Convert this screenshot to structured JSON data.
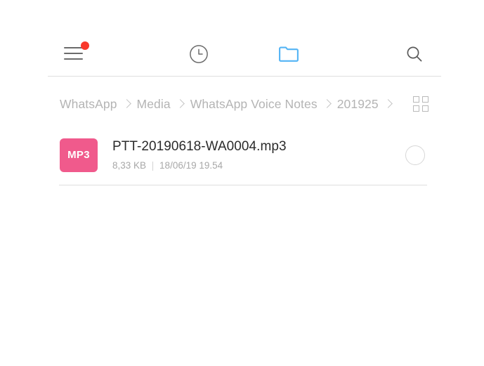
{
  "toolbar": {
    "menu": {
      "name": "menu-button",
      "label": "Menu",
      "badge_visible": true,
      "badge_color": "#f9382b"
    },
    "recent": {
      "name": "recent-button",
      "label": "Recent",
      "icon": "clock-icon",
      "color": "#6b6b6b"
    },
    "folders": {
      "name": "folders-button",
      "label": "Folders",
      "icon": "folder-icon",
      "color": "#53b4f5",
      "active": true
    },
    "search": {
      "name": "search-button",
      "label": "Search",
      "icon": "search-icon",
      "color": "#5a5a5a"
    }
  },
  "breadcrumb": {
    "items": [
      {
        "label": "WhatsApp"
      },
      {
        "label": "Media"
      },
      {
        "label": "WhatsApp Voice Notes"
      },
      {
        "label": "201925"
      }
    ],
    "separator": "chevron-right",
    "trailing_separator": true
  },
  "view_toggle": {
    "label": "Grid view",
    "icon": "grid-icon",
    "mode": "list"
  },
  "file_list": {
    "items": [
      {
        "name": "PTT-20190618-WA0004.mp3",
        "type_label": "MP3",
        "type_color": "#f05a8c",
        "size": "8,33 KB",
        "modified": "18/06/19 19.54",
        "selected": false
      }
    ]
  },
  "colors": {
    "background": "#ffffff",
    "divider": "#dedede",
    "text_primary": "#2b2b2b",
    "text_secondary": "#a8a8a8",
    "breadcrumb_text": "#b4b4b4",
    "accent_pink": "#f05a8c",
    "accent_blue": "#53b4f5",
    "badge_red": "#f9382b"
  }
}
